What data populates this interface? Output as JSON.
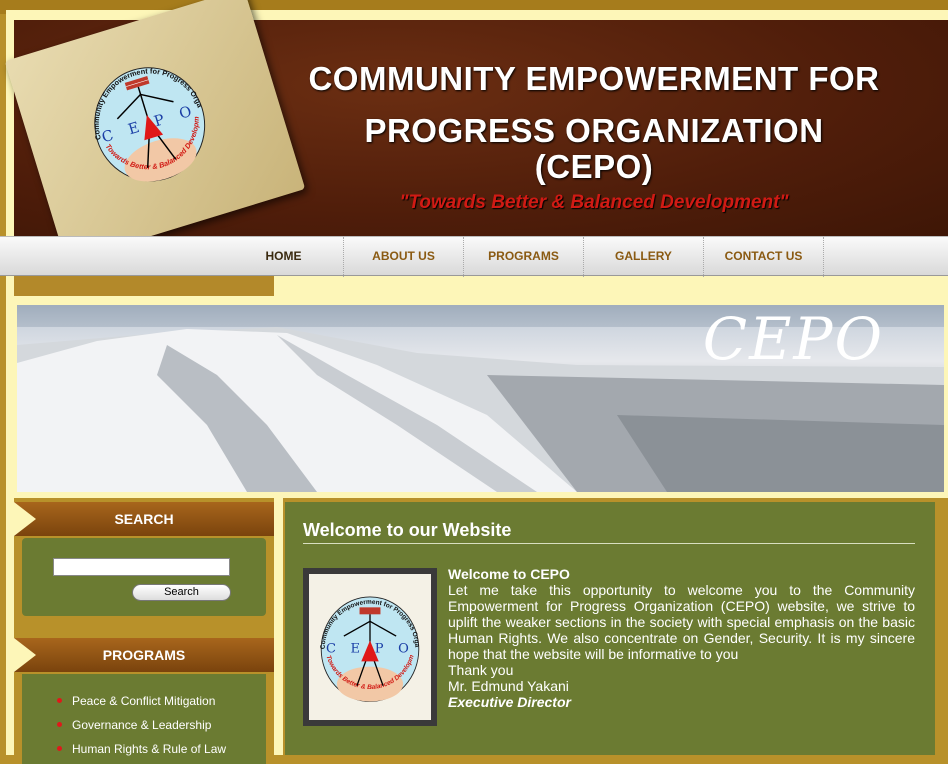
{
  "header": {
    "title_line1": "COMMUNITY EMPOWERMENT FOR",
    "title_line2": "PROGRESS ORGANIZATION",
    "title_line3": "(CEPO)",
    "tagline": "\"Towards Better & Balanced Development\""
  },
  "logo": {
    "ring_text": "Community Empowerment for Progress Organization",
    "letters": "C E P O",
    "motto": "Towards Better & Balanced Development"
  },
  "nav": {
    "items": [
      {
        "label": "HOME"
      },
      {
        "label": "ABOUT US"
      },
      {
        "label": "PROGRAMS"
      },
      {
        "label": "GALLERY"
      },
      {
        "label": "CONTACT US"
      }
    ]
  },
  "banner": {
    "word": "CEPO"
  },
  "sidebar": {
    "search_heading": "SEARCH",
    "search_value": "",
    "search_button": "Search",
    "programs_heading": "PROGRAMS",
    "programs": [
      {
        "label": "Peace & Conflict Mitigation"
      },
      {
        "label": "Governance & Leadership"
      },
      {
        "label": "Human Rights & Rule of Law"
      }
    ]
  },
  "main": {
    "heading": "Welcome to our Website",
    "content_title": "Welcome to CEPO",
    "body": "Let me take this opportunity to welcome you to the Community Empowerment for Progress Organization (CEPO) website, we strive to uplift the weaker sections in the society with special emphasis on the basic Human Rights. We also concentrate on Gender, Security. It is my sincere hope that the website will be informative to you",
    "thanks": "Thank you",
    "signer": "Mr. Edmund Yakani",
    "signer_title": "Executive Director"
  },
  "colors": {
    "header_brown": "#4f1d0a",
    "nav_text": "#8a5a12",
    "olive": "#6b7b32",
    "gold": "#b8912a",
    "cream": "#fdf6b8",
    "tagline_red": "#d11a14"
  }
}
